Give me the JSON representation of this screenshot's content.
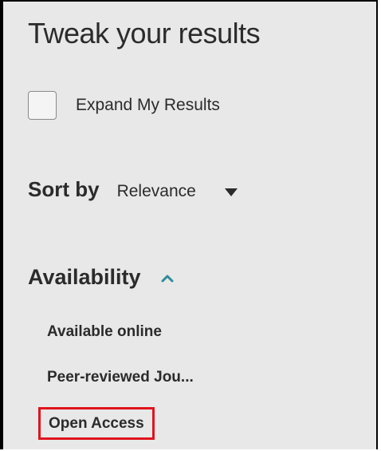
{
  "panel": {
    "title": "Tweak your results"
  },
  "expand": {
    "label": "Expand My Results"
  },
  "sort": {
    "label": "Sort by",
    "value": "Relevance"
  },
  "availability": {
    "label": "Availability",
    "items": [
      {
        "label": "Available online"
      },
      {
        "label": "Peer-reviewed Jou..."
      },
      {
        "label": "Open Access"
      }
    ]
  },
  "colors": {
    "panel_bg": "#e8e8e8",
    "text": "#2b2b2b",
    "chevron": "#2e8b9a",
    "highlight_border": "#e0141e"
  },
  "icons": {
    "sort_dropdown": "triangle-down-icon",
    "availability_toggle": "chevron-up-icon"
  }
}
